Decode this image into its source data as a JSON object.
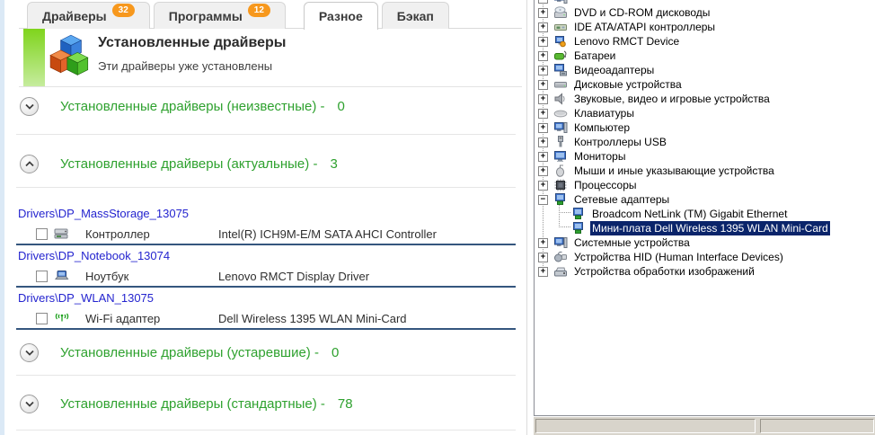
{
  "tabs": [
    {
      "id": "drivers",
      "label": "Драйверы",
      "badge": "32",
      "active": false
    },
    {
      "id": "programs",
      "label": "Программы",
      "badge": "12",
      "active": false
    },
    {
      "id": "misc",
      "label": "Разное",
      "badge": "",
      "active": true
    },
    {
      "id": "backup",
      "label": "Бэкап",
      "badge": "",
      "active": false
    }
  ],
  "banner": {
    "icon": "cubes-icon",
    "title": "Установленные драйверы",
    "subtitle": "Эти драйверы уже установлены"
  },
  "sections": [
    {
      "label": "Установленные драйверы (неизвестные) -",
      "count": "0",
      "state": "collapsed"
    },
    {
      "label": "Установленные драйверы (актуальные) -",
      "count": "3",
      "state": "expanded"
    },
    {
      "label": "Установленные драйверы (устаревшие) -",
      "count": "0",
      "state": "collapsed"
    },
    {
      "label": "Установленные драйверы (стандартные) -",
      "count": "78",
      "state": "collapsed"
    }
  ],
  "driver_groups": [
    {
      "path": "Drivers\\DP_MassStorage_13075",
      "icon": "controller-icon",
      "checked": false,
      "device_type": "Контроллер",
      "device_name": "Intel(R) ICH9M-E/M SATA AHCI Controller"
    },
    {
      "path": "Drivers\\DP_Notebook_13074",
      "icon": "notebook-icon",
      "checked": false,
      "device_type": "Ноутбук",
      "device_name": "Lenovo RMCT Display Driver"
    },
    {
      "path": "Drivers\\DP_WLAN_13075",
      "icon": "wifi-icon",
      "checked": false,
      "device_type": "Wi-Fi адаптер",
      "device_name": "Dell Wireless 1395 WLAN Mini-Card"
    }
  ],
  "device_tree": {
    "root": {
      "label": "",
      "icon": "computer-icon",
      "expand": "minus"
    },
    "items": [
      {
        "label": "DVD и CD-ROM дисководы",
        "icon": "cd-drive-icon",
        "expand": "plus"
      },
      {
        "label": "IDE ATA/ATAPI контроллеры",
        "icon": "ide-controller-icon",
        "expand": "plus"
      },
      {
        "label": "Lenovo RMCT Device",
        "icon": "lenovo-device-icon",
        "expand": "plus"
      },
      {
        "label": "Батареи",
        "icon": "battery-icon",
        "expand": "plus"
      },
      {
        "label": "Видеоадаптеры",
        "icon": "video-adapter-icon",
        "expand": "plus"
      },
      {
        "label": "Дисковые устройства",
        "icon": "disk-drive-icon",
        "expand": "plus"
      },
      {
        "label": "Звуковые, видео и игровые устройства",
        "icon": "audio-device-icon",
        "expand": "plus"
      },
      {
        "label": "Клавиатуры",
        "icon": "keyboard-icon",
        "expand": "plus"
      },
      {
        "label": "Компьютер",
        "icon": "computer-icon",
        "expand": "plus"
      },
      {
        "label": "Контроллеры USB",
        "icon": "usb-icon",
        "expand": "plus"
      },
      {
        "label": "Мониторы",
        "icon": "monitor-icon",
        "expand": "plus"
      },
      {
        "label": "Мыши и иные указывающие устройства",
        "icon": "mouse-icon",
        "expand": "plus"
      },
      {
        "label": "Процессоры",
        "icon": "processor-icon",
        "expand": "plus"
      },
      {
        "label": "Сетевые адаптеры",
        "icon": "network-adapter-icon",
        "expand": "minus",
        "children": [
          {
            "label": "Broadcom NetLink (TM) Gigabit Ethernet",
            "icon": "network-adapter-icon",
            "selected": false
          },
          {
            "label": "Мини-плата Dell Wireless 1395 WLAN Mini-Card",
            "icon": "network-adapter-icon",
            "selected": true
          }
        ]
      },
      {
        "label": "Системные устройства",
        "icon": "system-device-icon",
        "expand": "plus"
      },
      {
        "label": "Устройства HID (Human Interface Devices)",
        "icon": "hid-device-icon",
        "expand": "plus"
      },
      {
        "label": "Устройства обработки изображений",
        "icon": "imaging-device-icon",
        "expand": "plus"
      }
    ]
  },
  "colors": {
    "accent_green": "#2ea12e",
    "link_blue": "#2424cf",
    "badge_orange": "#f7981d",
    "selection_navy": "#0a246a",
    "divider_navy": "#35567e",
    "banner_green_top": "#7fd41c",
    "banner_green_bottom": "#c6ec9e"
  }
}
